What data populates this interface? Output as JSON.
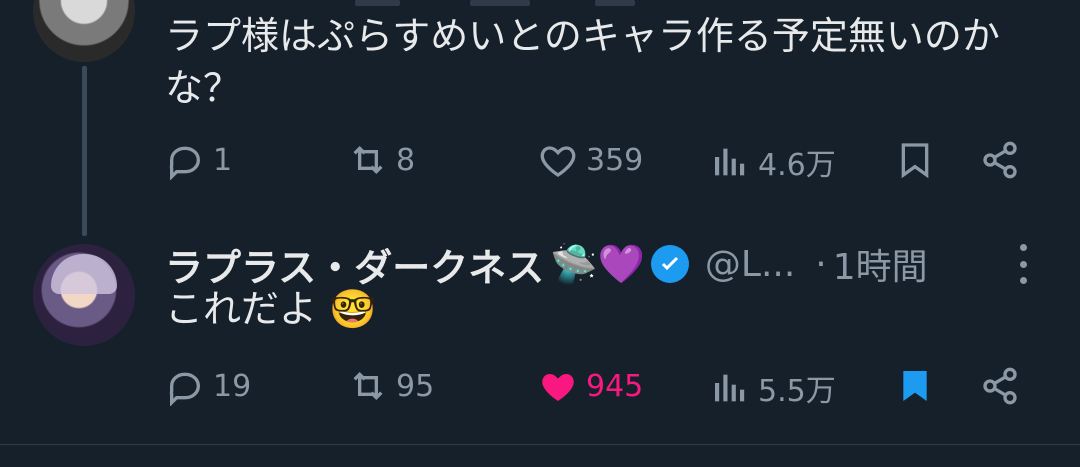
{
  "tweet1": {
    "text": "ラプ様はぷらすめいとのキャラ作る予定無いのかな？",
    "replies": "1",
    "retweets": "8",
    "likes": "359",
    "views": "4.6万"
  },
  "tweet2": {
    "display_name": "ラプラス・ダークネス",
    "name_emojis": "🛸💜",
    "handle": "@L...",
    "time": "1時間",
    "text": "これだよ 🤓",
    "replies": "19",
    "retweets": "95",
    "likes": "945",
    "views": "5.5万",
    "liked": true,
    "bookmarked": true
  },
  "colors": {
    "background": "#15202b",
    "text": "#e7e9ea",
    "muted": "#8b98a5",
    "like_active": "#f91880",
    "bookmark_active": "#1d9bf0",
    "verified": "#1d9bf0"
  }
}
